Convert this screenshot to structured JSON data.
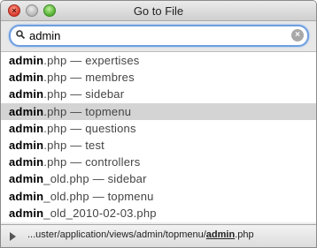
{
  "window": {
    "title": "Go to File"
  },
  "search": {
    "query": "admin",
    "clear_symbol": "×"
  },
  "results": [
    {
      "match": "admin",
      "rest": ".php — expertises",
      "selected": false
    },
    {
      "match": "admin",
      "rest": ".php — membres",
      "selected": false
    },
    {
      "match": "admin",
      "rest": ".php — sidebar",
      "selected": false
    },
    {
      "match": "admin",
      "rest": ".php — topmenu",
      "selected": true
    },
    {
      "match": "admin",
      "rest": ".php — questions",
      "selected": false
    },
    {
      "match": "admin",
      "rest": ".php — test",
      "selected": false
    },
    {
      "match": "admin",
      "rest": ".php — controllers",
      "selected": false
    },
    {
      "match": "admin",
      "rest": "_old.php — sidebar",
      "selected": false
    },
    {
      "match": "admin",
      "rest": "_old.php — topmenu",
      "selected": false
    },
    {
      "match": "admin",
      "rest": "_old_2010-02-03.php",
      "selected": false
    }
  ],
  "path_bar": {
    "prefix": "...uster/application/views/admin/topmenu/",
    "match": "admin",
    "suffix": ".php"
  },
  "colors": {
    "selection": "#d4d4d4",
    "focus_ring": "#6f9ee0",
    "close_button": "#d9372b",
    "minimize_button": "#b5b5b5",
    "zoom_button": "#4fae2f"
  }
}
